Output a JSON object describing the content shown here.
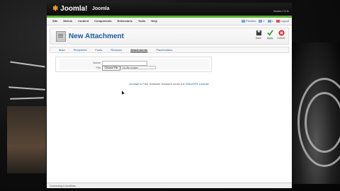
{
  "app": {
    "logo_text": "Joomla!",
    "site_name": "Joomla",
    "version": "Version 1.5.11"
  },
  "menu": [
    "Site",
    "Menus",
    "Content",
    "Components",
    "Extensions",
    "Tools",
    "Help"
  ],
  "status": {
    "preview": "Preview",
    "messages": "0",
    "users": "1",
    "logout": "Logout"
  },
  "page": {
    "title": "New Attachment"
  },
  "toolbar": {
    "save": "Save",
    "apply": "Apply",
    "cancel": "Cancel"
  },
  "tabs": [
    "Main",
    "Recipients",
    "Fonts",
    "Reasons",
    "Attachments",
    "Placeholders"
  ],
  "active_tab": "Attachments",
  "form": {
    "name_label": "Name",
    "file_label": "File",
    "file_button": "Choose File",
    "file_value": "No file chosen"
  },
  "footer": {
    "link": "Joomla!",
    "text": " is Free Software released under the ",
    "license": "GNU/GPL License."
  },
  "statusbar": {
    "text": "Connecting to localhost..."
  }
}
